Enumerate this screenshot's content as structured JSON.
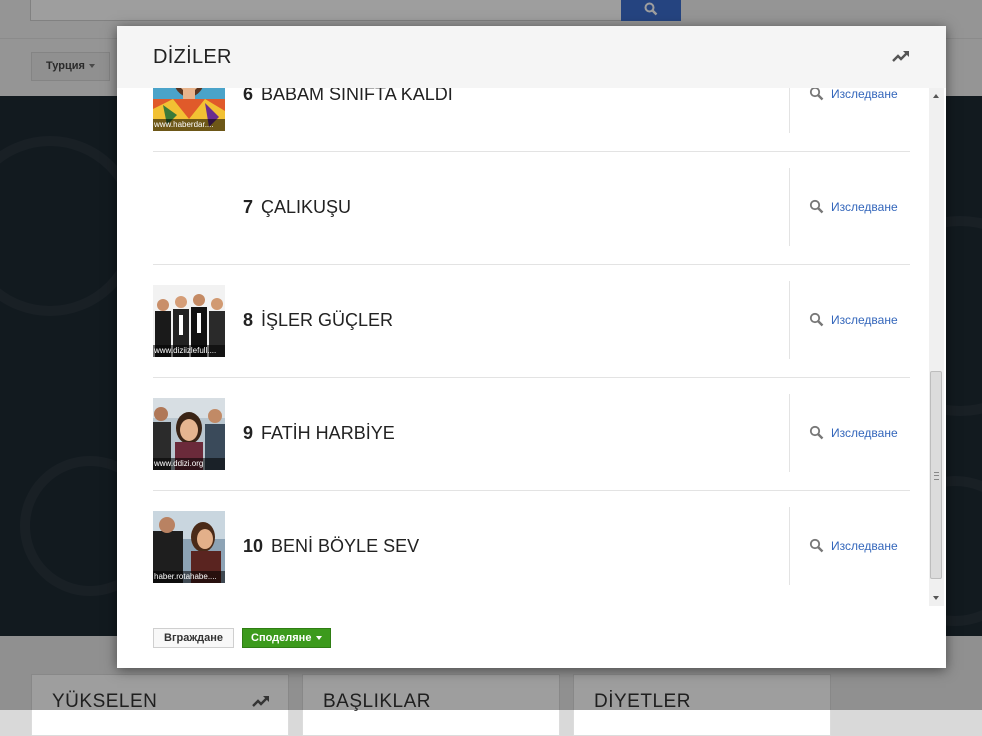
{
  "background": {
    "region_filter": "Турция",
    "cards": [
      {
        "title": "YÜKSELEN"
      },
      {
        "title": "BAŞLIKLAR"
      },
      {
        "title": "DİYETLER"
      }
    ]
  },
  "modal": {
    "title": "DİZİLER",
    "trend_icon": "trending-up-icon",
    "items": [
      {
        "rank": "6",
        "name": "BABAM SINIFTA KALDI",
        "thumb_caption": "www.haberdar....",
        "explore": "Изследване"
      },
      {
        "rank": "7",
        "name": "ÇALIKUŞU",
        "thumb_caption": "",
        "explore": "Изследване"
      },
      {
        "rank": "8",
        "name": "İŞLER GÜÇLER",
        "thumb_caption": "www.diziizlefull....",
        "explore": "Изследване"
      },
      {
        "rank": "9",
        "name": "FATİH HARBİYE",
        "thumb_caption": "www.ddizi.org",
        "explore": "Изследване"
      },
      {
        "rank": "10",
        "name": "BENİ BÖYLE SEV",
        "thumb_caption": "haber.rotahabe....",
        "explore": "Изследване"
      }
    ],
    "footer": {
      "embed_label": "Вграждане",
      "share_label": "Споделяне"
    }
  },
  "colors": {
    "link": "#3366bb",
    "share_button": "#3c9a1c",
    "search_button": "#3d6ecf"
  }
}
